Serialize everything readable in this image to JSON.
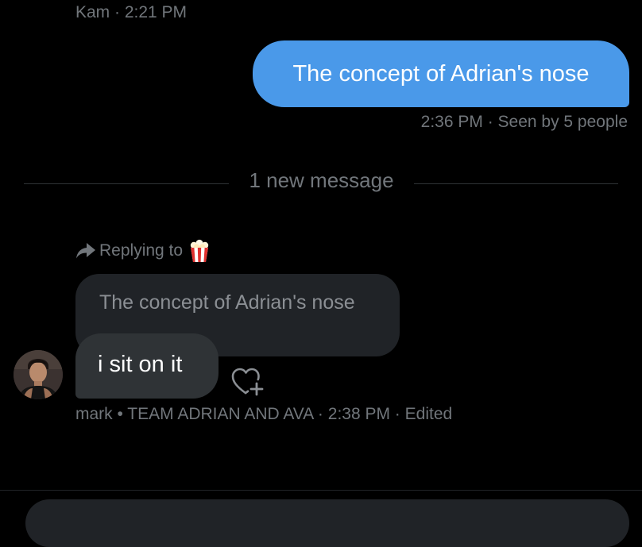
{
  "thread": {
    "previous_meta": "Kam · 2:21 PM",
    "sent_message": {
      "text": "The concept of Adrian's nose",
      "meta": "2:36 PM · Seen by 5 people"
    },
    "divider_label": "1 new message",
    "reply": {
      "replying_to_label": "Replying to",
      "replying_to_icon": "popcorn-emoji",
      "quoted_text": "The concept of Adrian's nose",
      "message_text": "i sit on it",
      "meta": "mark • TEAM ADRIAN AND AVA · 2:38 PM · Edited",
      "react_icon": "heart-plus-icon"
    }
  },
  "colors": {
    "background": "#000000",
    "sent_bubble": "#4a99e9",
    "received_bubble": "#2f3336",
    "quote_bubble": "#202327",
    "muted_text": "#71767b"
  }
}
